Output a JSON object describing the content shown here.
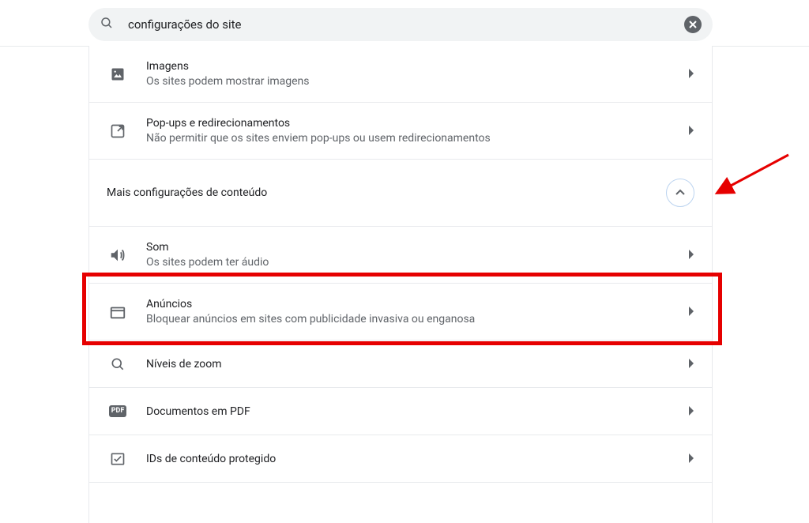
{
  "search": {
    "value": "configurações do site"
  },
  "rows": {
    "imagens": {
      "title": "Imagens",
      "sub": "Os sites podem mostrar imagens"
    },
    "popups": {
      "title": "Pop-ups e redirecionamentos",
      "sub": "Não permitir que os sites enviem pop-ups ou usem redirecionamentos"
    },
    "som": {
      "title": "Som",
      "sub": "Os sites podem ter áudio"
    },
    "anuncios": {
      "title": "Anúncios",
      "sub": "Bloquear anúncios em sites com publicidade invasiva ou enganosa"
    },
    "zoom": {
      "title": "Níveis de zoom"
    },
    "pdf": {
      "title": "Documentos em PDF",
      "badge": "PDF"
    },
    "ids": {
      "title": "IDs de conteúdo protegido"
    }
  },
  "section_header": "Mais configurações de conteúdo"
}
